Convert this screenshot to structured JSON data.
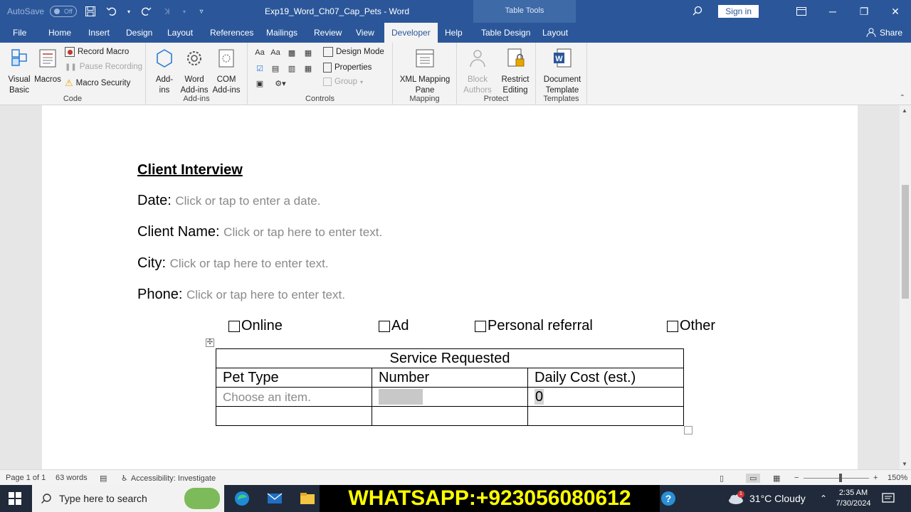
{
  "titlebar": {
    "autosave_label": "AutoSave",
    "autosave_state": "Off",
    "document_title": "Exp19_Word_Ch07_Cap_Pets  -  Word",
    "contextual_group": "Table Tools",
    "sign_in": "Sign in"
  },
  "tabs": [
    "File",
    "Home",
    "Insert",
    "Design",
    "Layout",
    "References",
    "Mailings",
    "Review",
    "View",
    "Developer",
    "Help",
    "Table Design",
    "Layout"
  ],
  "active_tab": "Developer",
  "share_label": "Share",
  "ribbon": {
    "code": {
      "visual_basic": "Visual Basic",
      "macros": "Macros",
      "record_macro": "Record Macro",
      "pause_recording": "Pause Recording",
      "macro_security": "Macro Security",
      "label": "Code"
    },
    "addins": {
      "add_ins": "Add-ins",
      "word_add_ins": "Word Add-ins",
      "com_add_ins": "COM Add-ins",
      "label": "Add-ins"
    },
    "controls": {
      "design_mode": "Design Mode",
      "properties": "Properties",
      "group": "Group",
      "label": "Controls"
    },
    "mapping": {
      "xml_mapping_pane": "XML Mapping Pane",
      "label": "Mapping"
    },
    "protect": {
      "block_authors": "Block Authors",
      "restrict_editing": "Restrict Editing",
      "label": "Protect"
    },
    "templates": {
      "document_template": "Document Template",
      "label": "Templates"
    }
  },
  "document": {
    "heading": "Client Interview",
    "fields": [
      {
        "label": "Date:",
        "placeholder": "Click or tap to enter a date."
      },
      {
        "label": "Client Name:",
        "placeholder": "Click or tap here to enter text."
      },
      {
        "label": "City:",
        "placeholder": "Click or tap here to enter text."
      },
      {
        "label": "Phone:",
        "placeholder": "Click or tap here to enter text."
      }
    ],
    "checkboxes": [
      "Online",
      "Ad",
      "Personal referral",
      "Other"
    ],
    "table": {
      "title": "Service Requested",
      "headers": [
        "Pet Type",
        "Number",
        "Daily Cost (est.)"
      ],
      "row1": {
        "pet_type": "Choose an item.",
        "number": "",
        "daily_cost": "0"
      }
    }
  },
  "statusbar": {
    "page": "Page 1 of 1",
    "words": "63 words",
    "accessibility": "Accessibility: Investigate",
    "zoom": "150%"
  },
  "taskbar": {
    "search_placeholder": "Type here to search",
    "banner": "WHATSAPP:+923056080612",
    "weather": "31°C  Cloudy",
    "time": "2:35 AM",
    "date": "7/30/2024",
    "weather_badge": "1"
  },
  "colors": {
    "word_blue": "#2b579a",
    "placeholder_gray": "#8a8a8a",
    "banner_text": "#ffff00"
  }
}
